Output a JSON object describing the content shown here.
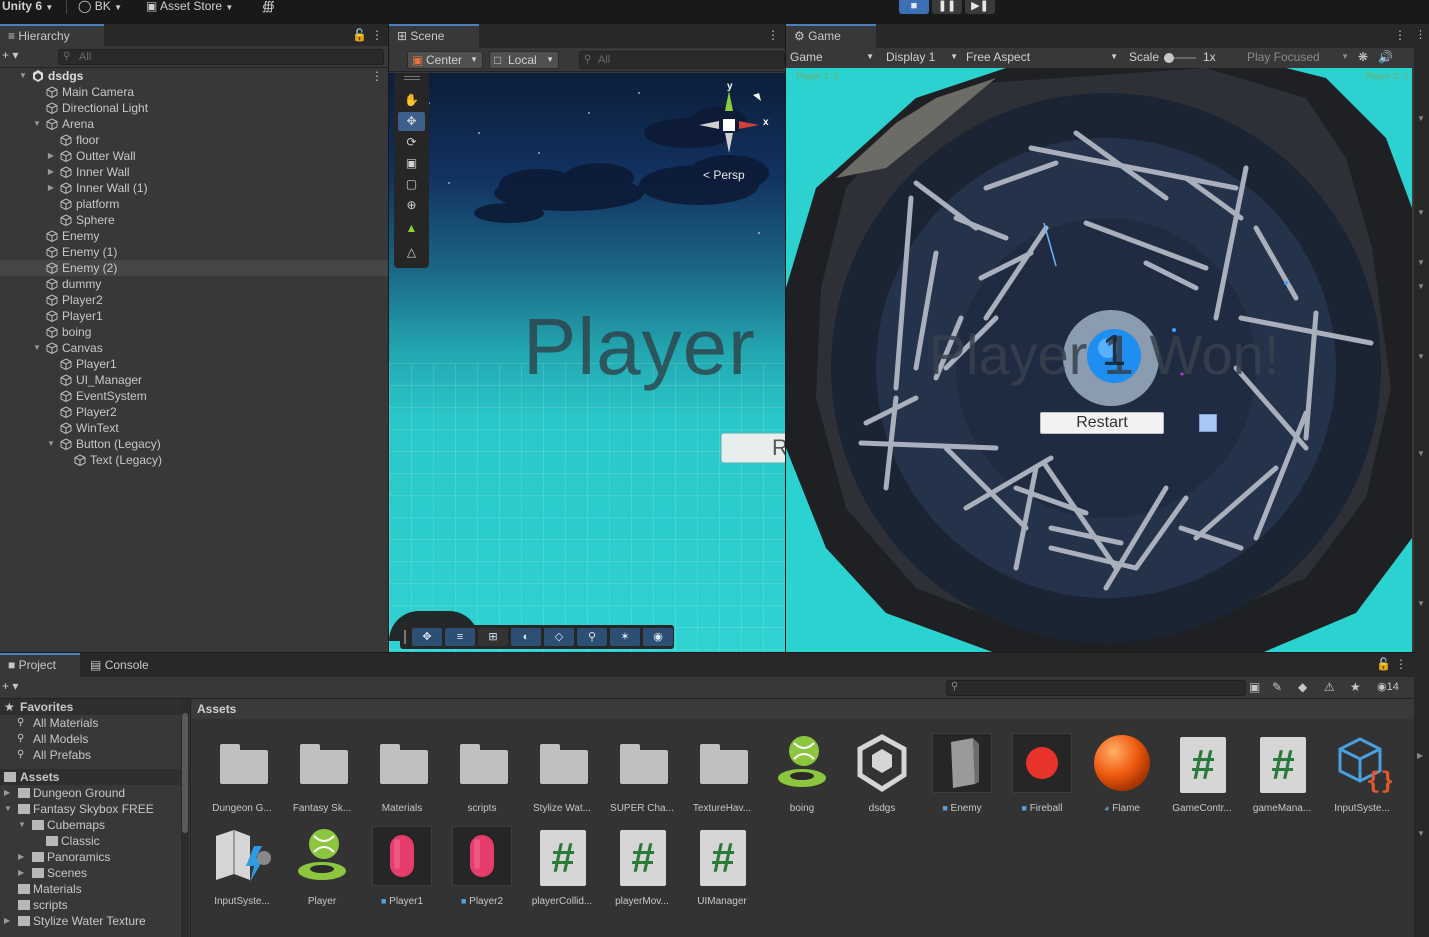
{
  "topbar": {
    "unity_label": "Unity 6",
    "account_label": "BK",
    "asset_store_label": "Asset Store",
    "play_icons": [
      "stop-icon",
      "pause-icon",
      "step-icon"
    ]
  },
  "hierarchy": {
    "tab_label": "Hierarchy",
    "search_placeholder": "All",
    "items": [
      {
        "label": "dsdgs",
        "depth": 0,
        "arrow": "open",
        "scene": true
      },
      {
        "label": "Main Camera",
        "depth": 1,
        "arrow": "none"
      },
      {
        "label": "Directional Light",
        "depth": 1,
        "arrow": "none"
      },
      {
        "label": "Arena",
        "depth": 1,
        "arrow": "open"
      },
      {
        "label": "floor",
        "depth": 2,
        "arrow": "none"
      },
      {
        "label": "Outter Wall",
        "depth": 2,
        "arrow": "closed"
      },
      {
        "label": "Inner Wall",
        "depth": 2,
        "arrow": "closed"
      },
      {
        "label": "Inner Wall (1)",
        "depth": 2,
        "arrow": "closed"
      },
      {
        "label": "platform",
        "depth": 2,
        "arrow": "none"
      },
      {
        "label": "Sphere",
        "depth": 2,
        "arrow": "none"
      },
      {
        "label": "Enemy",
        "depth": 1,
        "arrow": "none"
      },
      {
        "label": "Enemy (1)",
        "depth": 1,
        "arrow": "none"
      },
      {
        "label": "Enemy (2)",
        "depth": 1,
        "arrow": "none",
        "selected": true
      },
      {
        "label": "dummy",
        "depth": 1,
        "arrow": "none"
      },
      {
        "label": "Player2",
        "depth": 1,
        "arrow": "none"
      },
      {
        "label": "Player1",
        "depth": 1,
        "arrow": "none"
      },
      {
        "label": "boing",
        "depth": 1,
        "arrow": "none"
      },
      {
        "label": "Canvas",
        "depth": 1,
        "arrow": "open"
      },
      {
        "label": "Player1",
        "depth": 2,
        "arrow": "none"
      },
      {
        "label": "UI_Manager",
        "depth": 2,
        "arrow": "none"
      },
      {
        "label": "EventSystem",
        "depth": 2,
        "arrow": "none"
      },
      {
        "label": "Player2",
        "depth": 2,
        "arrow": "none"
      },
      {
        "label": "WinText",
        "depth": 2,
        "arrow": "none"
      },
      {
        "label": "Button (Legacy)",
        "depth": 2,
        "arrow": "open"
      },
      {
        "label": "Text (Legacy)",
        "depth": 3,
        "arrow": "none"
      }
    ]
  },
  "scene": {
    "tab_label": "Scene",
    "pivot_label": "Center",
    "space_label": "Local",
    "search_placeholder": "All",
    "persp_label": "< Persp",
    "gizmo_y": "y",
    "gizmo_x": "x",
    "world_text": "Player",
    "world_button_text": "R"
  },
  "game": {
    "tab_label": "Game",
    "mode_label": "Game",
    "display_label": "Display 1",
    "aspect_label": "Free Aspect",
    "scale_label": "Scale",
    "scale_value": "1x",
    "play_focused_label": "Play Focused",
    "player1_score": "Player 1: 0",
    "player2_score": "Player 2: 0",
    "win_text": "Player 1 Won!",
    "center_number": "1",
    "restart_label": "Restart"
  },
  "project": {
    "tab_project": "Project",
    "tab_console": "Console",
    "hidden_count": "14",
    "breadcrumb": "Assets",
    "favorites_label": "Favorites",
    "favorites": [
      "All Materials",
      "All Models",
      "All Prefabs"
    ],
    "assets_label": "Assets",
    "tree": [
      {
        "label": "Dungeon Ground",
        "depth": 1,
        "arrow": "closed"
      },
      {
        "label": "Fantasy Skybox FREE",
        "depth": 1,
        "arrow": "open"
      },
      {
        "label": "Cubemaps",
        "depth": 2,
        "arrow": "open"
      },
      {
        "label": "Classic",
        "depth": 3,
        "arrow": "none"
      },
      {
        "label": "Panoramics",
        "depth": 2,
        "arrow": "closed"
      },
      {
        "label": "Scenes",
        "depth": 2,
        "arrow": "closed"
      },
      {
        "label": "Materials",
        "depth": 1,
        "arrow": "none"
      },
      {
        "label": "scripts",
        "depth": 1,
        "arrow": "none"
      },
      {
        "label": "Stylize Water Texture",
        "depth": 1,
        "arrow": "closed"
      }
    ],
    "assets": [
      {
        "name": "Dungeon G...",
        "kind": "folder"
      },
      {
        "name": "Fantasy Sk...",
        "kind": "folder"
      },
      {
        "name": "Materials",
        "kind": "folder"
      },
      {
        "name": "scripts",
        "kind": "folder"
      },
      {
        "name": "Stylize Wat...",
        "kind": "folder"
      },
      {
        "name": "SUPER Cha...",
        "kind": "folder"
      },
      {
        "name": "TextureHav...",
        "kind": "folder"
      },
      {
        "name": "boing",
        "kind": "physics-material"
      },
      {
        "name": "dsdgs",
        "kind": "scene"
      },
      {
        "name": "Enemy",
        "kind": "prefab-enemy"
      },
      {
        "name": "Fireball",
        "kind": "prefab-fireball"
      },
      {
        "name": "Flame",
        "kind": "material-flame"
      },
      {
        "name": "GameContr...",
        "kind": "script"
      },
      {
        "name": "gameMana...",
        "kind": "script"
      },
      {
        "name": "InputSyste...",
        "kind": "input-actions"
      },
      {
        "name": "InputSyste...",
        "kind": "input-map"
      },
      {
        "name": "Player",
        "kind": "physics-material"
      },
      {
        "name": "Player1",
        "kind": "prefab-player"
      },
      {
        "name": "Player2",
        "kind": "prefab-player"
      },
      {
        "name": "playerCollid...",
        "kind": "script"
      },
      {
        "name": "playerMov...",
        "kind": "script"
      },
      {
        "name": "UIManager",
        "kind": "script"
      }
    ]
  },
  "colors": {
    "accent": "#3d6fb5",
    "sky_cyan": "#2bd2cf",
    "script_green": "#2a7a3b",
    "physics_green": "#8cc63f"
  }
}
